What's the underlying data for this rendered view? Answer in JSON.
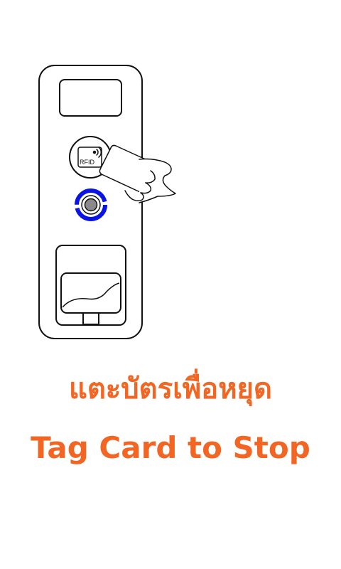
{
  "instruction": {
    "thai": "แตะบัตรเพื่อหยุด",
    "english": "Tag Card to Stop"
  },
  "reader": {
    "rfid_label": "RFID"
  },
  "colors": {
    "text_accent": "#f26522",
    "ring_blue": "#0a14e6",
    "outline": "#111111",
    "background": "#ffffff"
  }
}
